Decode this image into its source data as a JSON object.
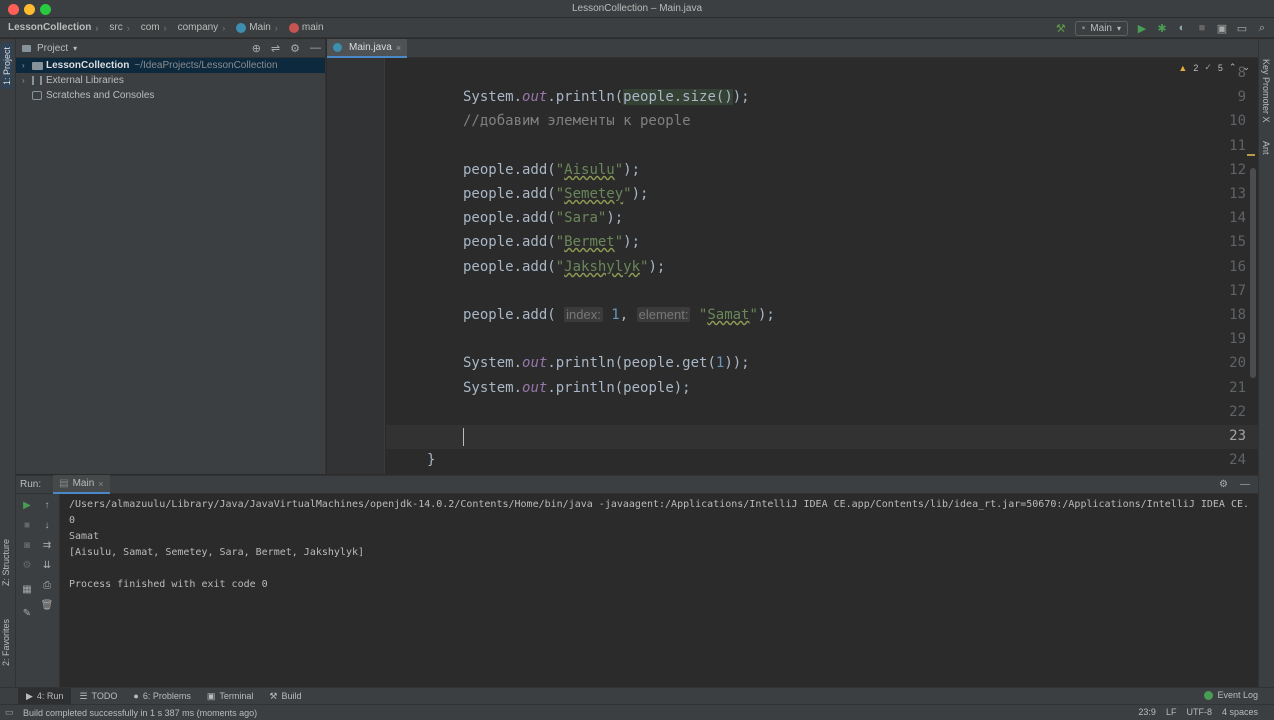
{
  "window": {
    "title": "LessonCollection – Main.java"
  },
  "navbar": {
    "crumbs": [
      "LessonCollection",
      "src",
      "com",
      "company",
      "Main",
      "main"
    ],
    "run_config": "Main"
  },
  "left_strip": {
    "project": "1: Project",
    "structure": "Z: Structure",
    "favorites": "2: Favorites"
  },
  "right_strip": {
    "key_promoter": "Key Promoter X",
    "ant": "Ant"
  },
  "project_panel": {
    "title": "Project",
    "root": {
      "label": "LessonCollection",
      "path": "~/IdeaProjects/LessonCollection"
    },
    "items": [
      "External Libraries",
      "Scratches and Consoles"
    ]
  },
  "editor": {
    "tab": "Main.java",
    "warnings": {
      "warn_count": "2",
      "weak_count": "5"
    },
    "line_numbers": [
      "8",
      "9",
      "10",
      "11",
      "12",
      "13",
      "14",
      "15",
      "16",
      "17",
      "18",
      "19",
      "20",
      "21",
      "22",
      "23",
      "24"
    ],
    "code": {
      "l9_pre": "System.",
      "l9_out": "out",
      "l9_mid": ".println(",
      "l9_hl": "people.size()",
      "l9_end": ");",
      "l10": "//добавим элементы к people",
      "l12_pre": "people.add(",
      "l12_str": "Aisulu",
      "l12_end": ");",
      "l13_pre": "people.add(",
      "l13_str": "Semetey",
      "l13_end": ");",
      "l14_pre": "people.add(",
      "l14_str": "Sara",
      "l14_end": ");",
      "l15_pre": "people.add(",
      "l15_str": "Bermet",
      "l15_end": ");",
      "l16_pre": "people.add(",
      "l16_str": "Jakshylyk",
      "l16_end": ");",
      "l18_pre": "people.add( ",
      "l18_hint1": "index:",
      "l18_num": "1",
      "l18_comma": ", ",
      "l18_hint2": "element:",
      "l18_str": "Samat",
      "l18_end": ");",
      "l20_pre": "System.",
      "l20_out": "out",
      "l20_mid": ".println(people.get(",
      "l20_num": "1",
      "l20_end": "));",
      "l21_pre": "System.",
      "l21_out": "out",
      "l21_end": ".println(people);",
      "l24": "}"
    }
  },
  "run_panel": {
    "label": "Run:",
    "tab": "Main",
    "console": {
      "line1": "/Users/almazuulu/Library/Java/JavaVirtualMachines/openjdk-14.0.2/Contents/Home/bin/java -javaagent:/Applications/IntelliJ IDEA CE.app/Contents/lib/idea_rt.jar=50670:/Applications/IntelliJ IDEA CE.",
      "line2": "0",
      "line3": "Samat",
      "line4": "[Aisulu, Samat, Semetey, Sara, Bermet, Jakshylyk]",
      "line5": "",
      "line6": "Process finished with exit code 0"
    }
  },
  "bottom_tabs": [
    "4: Run",
    "TODO",
    "6: Problems",
    "Terminal",
    "Build"
  ],
  "event_log": "Event Log",
  "status": {
    "message": "Build completed successfully in 1 s 387 ms (moments ago)",
    "position": "23:9",
    "line_sep": "LF",
    "encoding": "UTF-8",
    "indent": "4 spaces"
  }
}
